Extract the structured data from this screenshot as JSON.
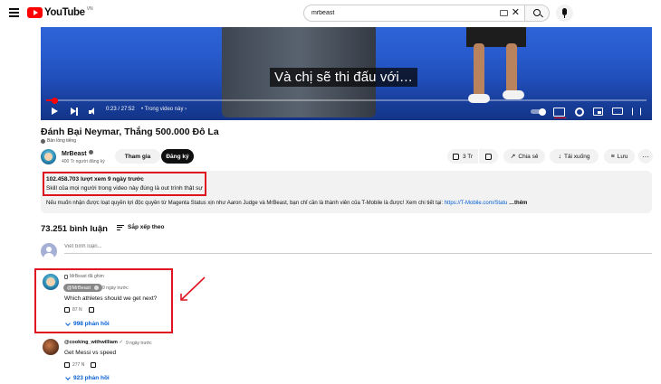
{
  "header": {
    "logo_text": "YouTube",
    "logo_region": "VN",
    "search_value": "mrbeast",
    "search_placeholder": "Tìm kiếm",
    "clear_symbol": "✕"
  },
  "player": {
    "subtitle": "Và chị sẽ thi đấu với…",
    "time": "0:23 / 27:52",
    "chapter": "• Trong video này ›",
    "progress_fraction": 0.014
  },
  "video": {
    "title": "Đánh Bại Neymar, Thắng 500.000 Đô La",
    "dubbed_label": "Bản lồng tiếng"
  },
  "channel": {
    "name": "MrBeast",
    "subscribers": "400 Tr người đăng ký",
    "join_label": "Tham gia",
    "subscribe_label": "Đăng ký"
  },
  "actions": {
    "likes": "3 Tr",
    "share_label": "Chia sẻ",
    "download_label": "Tải xuống",
    "save_label": "Lưu",
    "more_symbol": "···"
  },
  "description": {
    "stats": "102.458.703 lượt xem  9 ngày trước",
    "line1": "Skill của mọi người trong video này đúng là out trình thật sự",
    "line2_prefix": "Nếu muốn nhận được loạt quyền lợi độc quyền từ Magenta Status xịn như Aaron Judge và MrBeast, bạn chỉ cần là thành viên của T-Mobile là được! Xem chi tiết tại: ",
    "line2_link": "https://T-Mobile.com/Statu",
    "more_label": " …thêm"
  },
  "comments": {
    "count": "73.251 bình luận",
    "sort_label": "Sắp xếp theo",
    "input_placeholder": "Viết bình luận...",
    "items": [
      {
        "pinned_label": "MrBeast đã ghim",
        "author": "@MrBeast",
        "time": "9 ngày trước",
        "text": "Which athletes should we get next?",
        "likes": "87 N",
        "replies": "998 phản hồi"
      },
      {
        "author": "@cooking_withwilliam",
        "author_mark": "✓",
        "time": "9 ngày trước",
        "text": "Get Messi vs speed",
        "likes": "277 N",
        "replies": "923 phản hồi"
      }
    ]
  },
  "colors": {
    "annotation_red": "#e0141e",
    "brand_red": "#ff0000",
    "link_blue": "#065fd4"
  }
}
